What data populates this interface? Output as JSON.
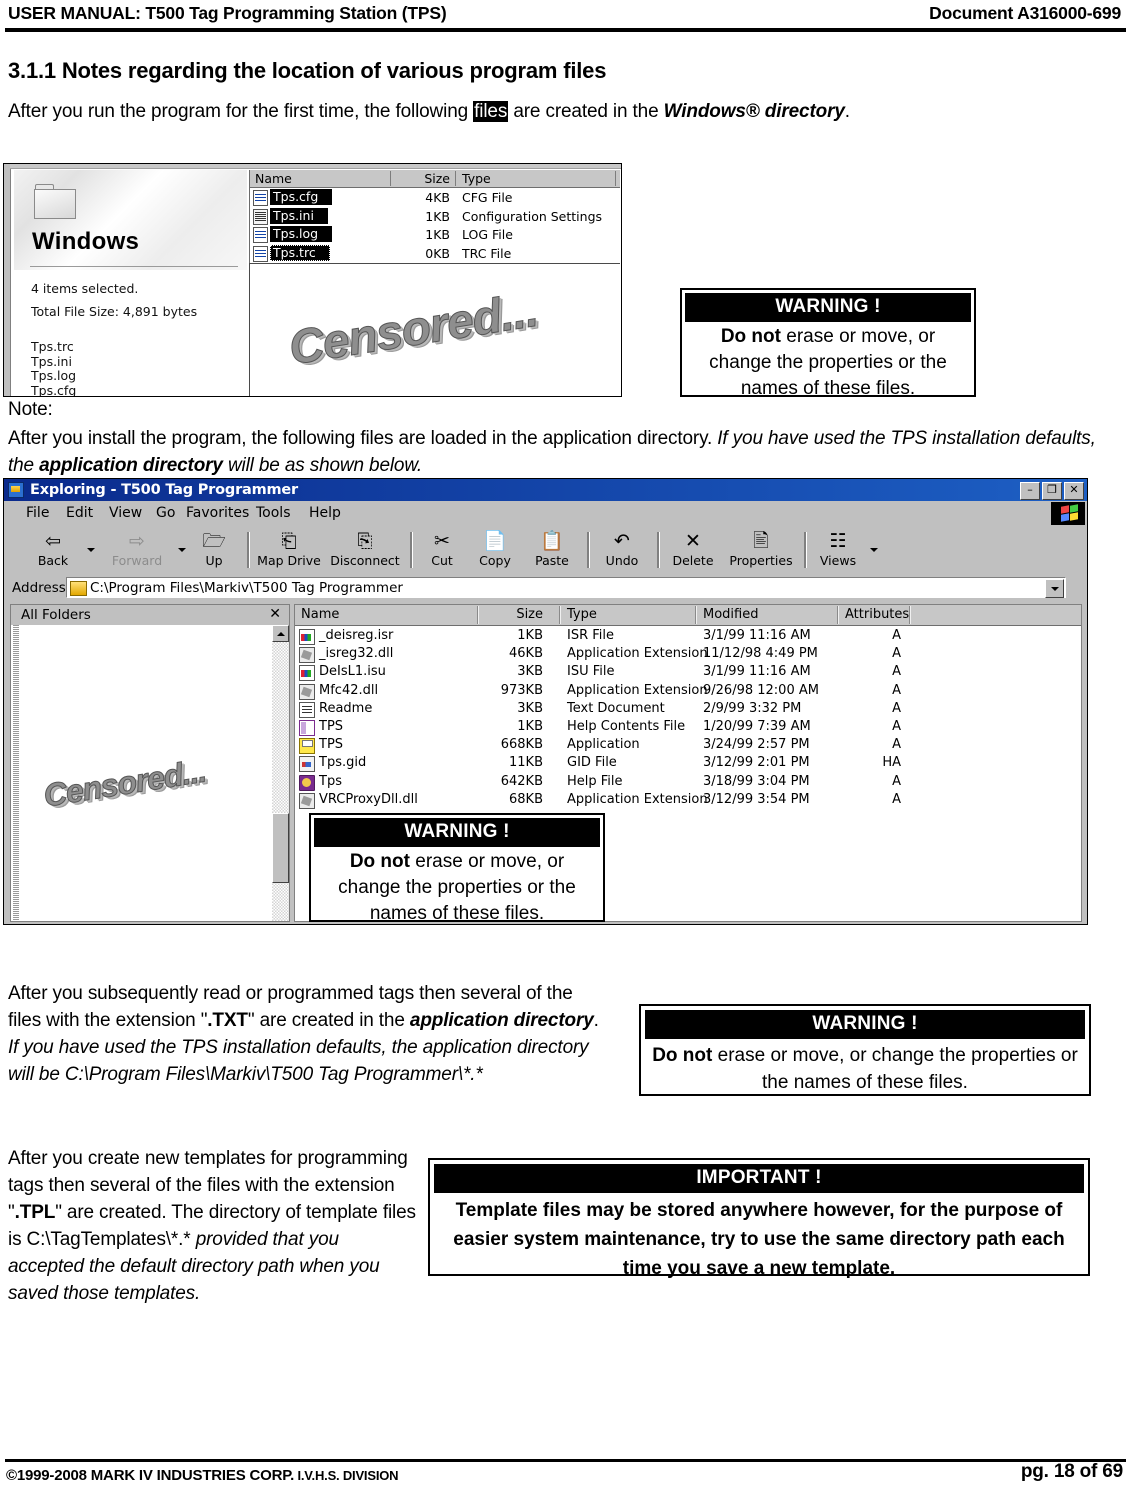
{
  "header": {
    "left_title": "USER MANUAL: T500 Tag Programming Station (TPS)",
    "right_title": "Document A316000-699"
  },
  "section": {
    "heading": "3.1.1 Notes regarding the location of various program files",
    "intro_before": "After you run the program for the first time, the following ",
    "intro_highlight": "files",
    "intro_middle": " are created in the ",
    "intro_bold_italic": "Windows® directory",
    "intro_after": "."
  },
  "note": {
    "label": "Note:",
    "line1_plain": "After you install the program, the following files are loaded in the application directory. ",
    "line1_italic": "If you have used the TPS installation defaults, the ",
    "line1_bold_italic": "application directory",
    "line1_italic_tail": " will be as shown below."
  },
  "windows_shot": {
    "folder_title": "Windows",
    "items_selected": "4 items selected.",
    "total_size": "Total File Size: 4,891 bytes",
    "selected_files": [
      "Tps.trc",
      "Tps.ini",
      "Tps.log",
      "Tps.cfg"
    ],
    "columns": [
      "Name",
      "Size",
      "Type"
    ],
    "rows": [
      {
        "name": "Tps.cfg",
        "size": "4KB",
        "type": "CFG File",
        "icon": "ic-doc"
      },
      {
        "name": "Tps.ini",
        "size": "1KB",
        "type": "Configuration Settings",
        "icon": "ic-ini"
      },
      {
        "name": "Tps.log",
        "size": "1KB",
        "type": "LOG File",
        "icon": "ic-doc"
      },
      {
        "name": "Tps.trc",
        "size": "0KB",
        "type": "TRC File",
        "icon": "ic-doc"
      }
    ],
    "censored_label": "Censored..."
  },
  "explorer": {
    "title": "Exploring - T500 Tag Programmer",
    "window_buttons": [
      "–",
      "❐",
      "✕"
    ],
    "menus": [
      "File",
      "Edit",
      "View",
      "Go",
      "Favorites",
      "Tools",
      "Help"
    ],
    "toolbar": [
      {
        "label": "Back",
        "glyph": "⇦",
        "dim": false
      },
      {
        "label": "Forward",
        "glyph": "⇨",
        "dim": true
      },
      {
        "label": "Up",
        "glyph": "↑",
        "dim": false
      },
      {
        "label": "Map Drive",
        "glyph": "⎗",
        "dim": false
      },
      {
        "label": "Disconnect",
        "glyph": "⎘",
        "dim": false
      },
      {
        "label": "Cut",
        "glyph": "✂",
        "dim": false
      },
      {
        "label": "Copy",
        "glyph": "❐",
        "dim": false
      },
      {
        "label": "Paste",
        "glyph": "Ὄb",
        "dim": false
      },
      {
        "label": "Undo",
        "glyph": "↶",
        "dim": false
      },
      {
        "label": "Delete",
        "glyph": "✕",
        "dim": false
      },
      {
        "label": "Properties",
        "glyph": "☰",
        "dim": false
      },
      {
        "label": "Views",
        "glyph": "☷",
        "dim": false
      }
    ],
    "address_label": "Address",
    "address_value": "C:\\Program Files\\Markiv\\T500 Tag Programmer",
    "left_panel_title": "All Folders",
    "left_panel_close": "✕",
    "censored_label": "Censored...",
    "columns": [
      "Name",
      "Size",
      "Type",
      "Modified",
      "Attributes"
    ],
    "rows": [
      {
        "name": "_deisreg.isr",
        "size": "1KB",
        "type": "ISR File",
        "modified": "3/1/99 11:16 AM",
        "attributes": "A",
        "icon": "i-isr"
      },
      {
        "name": "_isreg32.dll",
        "size": "46KB",
        "type": "Application Extension",
        "modified": "11/12/98 4:49 PM",
        "attributes": "A",
        "icon": "i-dll"
      },
      {
        "name": "DeIsL1.isu",
        "size": "3KB",
        "type": "ISU File",
        "modified": "3/1/99 11:16 AM",
        "attributes": "A",
        "icon": "i-isr"
      },
      {
        "name": "Mfc42.dll",
        "size": "973KB",
        "type": "Application Extension",
        "modified": "9/26/98 12:00 AM",
        "attributes": "A",
        "icon": "i-dll"
      },
      {
        "name": "Readme",
        "size": "3KB",
        "type": "Text Document",
        "modified": "2/9/99 3:32 PM",
        "attributes": "A",
        "icon": "i-txt"
      },
      {
        "name": "TPS",
        "size": "1KB",
        "type": "Help Contents File",
        "modified": "1/20/99 7:39 AM",
        "attributes": "A",
        "icon": "i-hlp"
      },
      {
        "name": "TPS",
        "size": "668KB",
        "type": "Application",
        "modified": "3/24/99 2:57 PM",
        "attributes": "A",
        "icon": "i-app"
      },
      {
        "name": "Tps.gid",
        "size": "11KB",
        "type": "GID File",
        "modified": "3/12/99 2:01 PM",
        "attributes": "HA",
        "icon": "i-gid"
      },
      {
        "name": "Tps",
        "size": "642KB",
        "type": "Help File",
        "modified": "3/18/99 3:04 PM",
        "attributes": "A",
        "icon": "i-hlpbook"
      },
      {
        "name": "VRCProxyDll.dll",
        "size": "68KB",
        "type": "Application Extension",
        "modified": "3/12/99 3:54 PM",
        "attributes": "A",
        "icon": "i-dll"
      }
    ]
  },
  "warning_1": {
    "title": "WARNING !",
    "body_bold": "Do not",
    "body_rest": " erase or move, or change the properties or the names of these files."
  },
  "warning_2": {
    "title": "WARNING !",
    "body_bold": "Do not",
    "body_rest": " erase or move, or change the properties or the names of these files."
  },
  "warning_3": {
    "title": "WARNING !",
    "body_bold": "Do not",
    "body_rest": " erase or move, or change the properties or the names of these files."
  },
  "important_1": {
    "title": "IMPORTANT !",
    "body": "Template files may be stored anywhere however, for the purpose of easier system maintenance, try to use the same directory path each time you save a new template."
  },
  "para_txt": {
    "p1": "After you subsequently read or programmed tags then several of the files with the extension \"",
    "ext": ".TXT",
    "p2": "\" are created in the ",
    "bi": "application directory",
    "p3": ". ",
    "italic": "If you have used the TPS installation defaults, the application directory will be C:\\Program Files\\Markiv\\T500 Tag Programmer\\*.*"
  },
  "para_tpl": {
    "p1": "After you create new templates for programming tags then several of the files with the extension \"",
    "ext": ".TPL",
    "p2": "\" are created. The directory of template files is C:\\TagTemplates\\*.* ",
    "italic": "provided that you accepted the default directory path when you saved those templates."
  },
  "footer": {
    "copyright_symbol": "©",
    "copyright_main": "1999-2008 MARK IV INDUSTRIES CORP.",
    "copyright_small": " I.V.H.S. DIVISION",
    "page": "pg. 18 of 69"
  }
}
